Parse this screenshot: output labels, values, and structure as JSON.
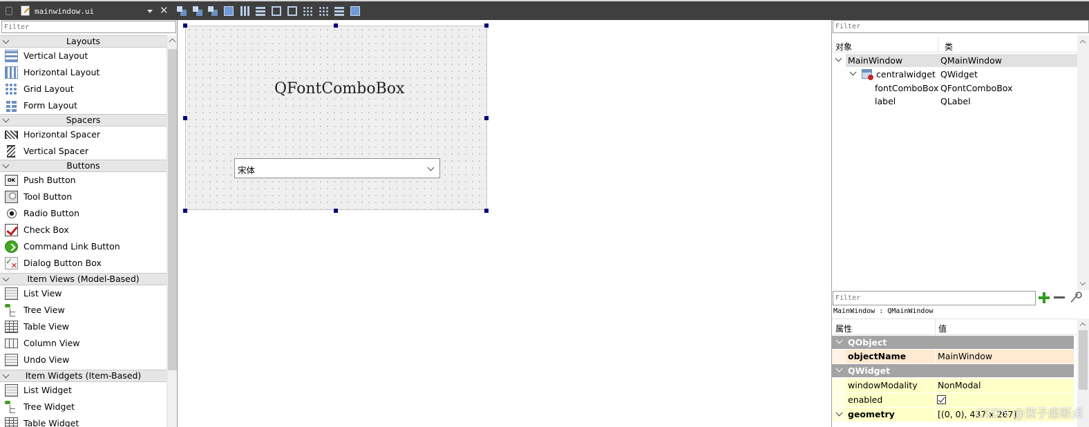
{
  "toolbar": {
    "file_name": "mainwindow.ui",
    "close_glyph": "✕",
    "icons": [
      "edit-widgets-icon",
      "edit-signals-icon",
      "edit-buddies-icon",
      "edit-tab-order-icon",
      "lay-out-horizontally-icon",
      "lay-out-vertically-icon",
      "lay-out-horizontal-splitter-icon",
      "lay-out-vertical-splitter-icon",
      "lay-out-form-icon",
      "lay-out-grid-icon",
      "break-layout-icon",
      "adjust-size-icon"
    ]
  },
  "widget_box": {
    "filter_placeholder": "Filter",
    "categories": {
      "layouts": "Layouts",
      "spacers": "Spacers",
      "buttons": "Buttons",
      "item_views": "Item Views (Model-Based)",
      "item_widgets": "Item Widgets (Item-Based)"
    },
    "items": {
      "vertical_layout": "Vertical Layout",
      "horizontal_layout": "Horizontal Layout",
      "grid_layout": "Grid Layout",
      "form_layout": "Form Layout",
      "horizontal_spacer": "Horizontal Spacer",
      "vertical_spacer": "Vertical Spacer",
      "push_button": "Push Button",
      "push_button_icon_text": "OK",
      "tool_button": "Tool Button",
      "radio_button": "Radio Button",
      "check_box": "Check Box",
      "command_link_button": "Command Link Button",
      "dialog_button_box": "Dialog Button Box",
      "list_view": "List View",
      "tree_view": "Tree View",
      "table_view": "Table View",
      "column_view": "Column View",
      "undo_view": "Undo View",
      "list_widget": "List Widget",
      "tree_widget": "Tree Widget",
      "table_widget": "Table Widget"
    }
  },
  "form": {
    "label_text": "QFontComboBox",
    "combo_value": "宋体"
  },
  "object_inspector": {
    "filter_placeholder": "Filter",
    "col_object": "对象",
    "col_class": "类",
    "rows": {
      "main_window": {
        "name": "MainWindow",
        "class": "QMainWindow"
      },
      "central_widget": {
        "name": "centralwidget",
        "class": "QWidget"
      },
      "font_combo_box": {
        "name": "fontComboBox",
        "class": "QFontComboBox"
      },
      "label": {
        "name": "label",
        "class": "QLabel"
      }
    }
  },
  "property_editor": {
    "filter_placeholder": "Filter",
    "object_caption": "MainWindow : QMainWindow",
    "col_property": "属性",
    "col_value": "值",
    "groups": {
      "qobject": "QObject",
      "qwidget": "QWidget"
    },
    "props": {
      "object_name": {
        "name": "objectName",
        "value": "MainWindow"
      },
      "window_modality": {
        "name": "windowModality",
        "value": "NonModal"
      },
      "enabled": {
        "name": "enabled",
        "value": true
      },
      "geometry": {
        "name": "geometry",
        "value": "[(0, 0), 437 x 267]"
      }
    }
  },
  "watermark": "CSDN @双子座断点",
  "colors": {
    "toolbar_bg": "#3f3f3f",
    "selection_handle": "#000080",
    "group_header_bg": "#a4a4a4",
    "qobject_row_bg": "#ffe9d0",
    "qwidget_row_bg": "#ffffc8"
  }
}
